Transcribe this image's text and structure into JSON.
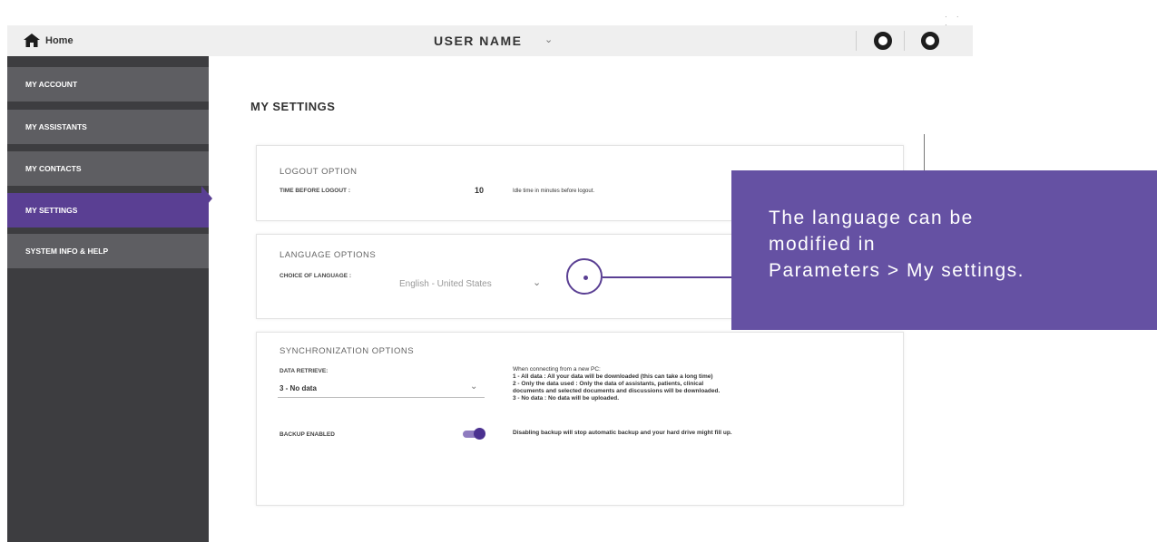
{
  "topbar": {
    "home_label": "Home",
    "home_icon": "house-icon",
    "username": "USER NAME",
    "username_dropdown_icon": "chevron-down-icon",
    "window_controls": "· · ·"
  },
  "sidebar": {
    "items": [
      {
        "label": "MY ACCOUNT"
      },
      {
        "label": "MY ASSISTANTS"
      },
      {
        "label": "MY CONTACTS"
      },
      {
        "label": "MY SETTINGS",
        "active": true
      },
      {
        "label": "SYSTEM INFO & HELP"
      }
    ]
  },
  "page": {
    "title": "MY SETTINGS"
  },
  "logout": {
    "section_title": "LOGOUT OPTION",
    "time_label": "TIME BEFORE LOGOUT :",
    "time_value": "10",
    "time_hint": "Idle time in minutes before logout."
  },
  "language": {
    "section_title": "LANGUAGE OPTIONS",
    "choice_label": "CHOICE OF LANGUAGE :",
    "selected": "English - United States"
  },
  "sync": {
    "section_title": "SYNCHRONIZATION OPTIONS",
    "data_retrieve_label": "DATA RETRIEVE:",
    "data_retrieve_value": "3 - No data",
    "info_lines": [
      "When connecting from a new PC:",
      "1 - All data : All your data will be downloaded (this can take a long time)",
      "2 - Only the data used : Only the data of assistants, patients, clinical",
      "documents and selected documents and discussions will be downloaded.",
      "3 - No data : No data will be uploaded."
    ],
    "backup_label": "BACKUP ENABLED",
    "backup_enabled": true,
    "backup_hint": "Disabling backup will stop automatic backup and your hard drive might fill up."
  },
  "callout": {
    "text_line1": "The language can be",
    "text_line2": "modified in",
    "text_line3": "Parameters > My settings."
  },
  "colors": {
    "accent": "#5a3f93",
    "callout_bg": "#6551a3",
    "sidebar_bg": "#3d3d40",
    "sidebar_item_bg": "#5e5e62"
  }
}
